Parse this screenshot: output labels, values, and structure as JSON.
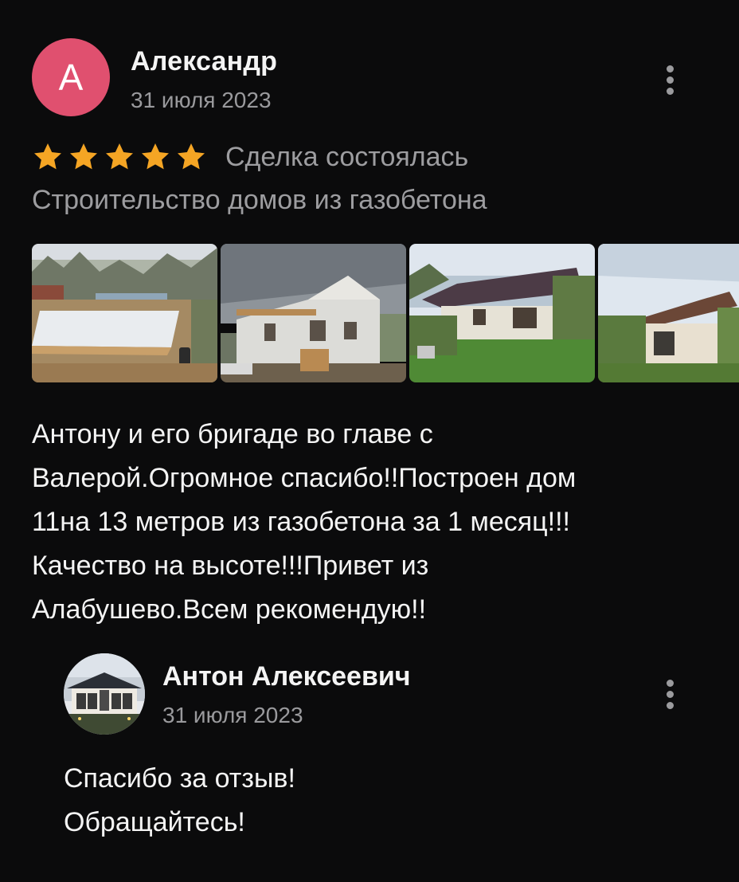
{
  "review": {
    "author": {
      "initial": "А",
      "name": "Александр",
      "date": "31 июля 2023",
      "avatar_color": "#e0506f"
    },
    "rating": 5,
    "rating_max": 5,
    "star_color": "#f5a524",
    "deal_status": "Сделка состоялась",
    "service_category": "Строительство домов из газобетона",
    "photos": [
      {
        "icon": "photo-foundation"
      },
      {
        "icon": "photo-house-walls"
      },
      {
        "icon": "photo-house-finished"
      },
      {
        "icon": "photo-house-garden"
      }
    ],
    "text": "Антону и его бригаде во главе с\nВалерой.Огромное спасибо!!Построен дом\n11на 13 метров из газобетона за 1 месяц!!!\nКачество на высоте!!!Привет из\nАлабушево.Всем рекомендую!!",
    "more_icon": "more-vertical-icon"
  },
  "reply": {
    "author": {
      "name": "Антон Алексеевич",
      "date": "31 июля 2023",
      "avatar_icon": "house-avatar"
    },
    "text": "Спасибо за отзыв!\nОбращайтесь!",
    "more_icon": "more-vertical-icon"
  }
}
